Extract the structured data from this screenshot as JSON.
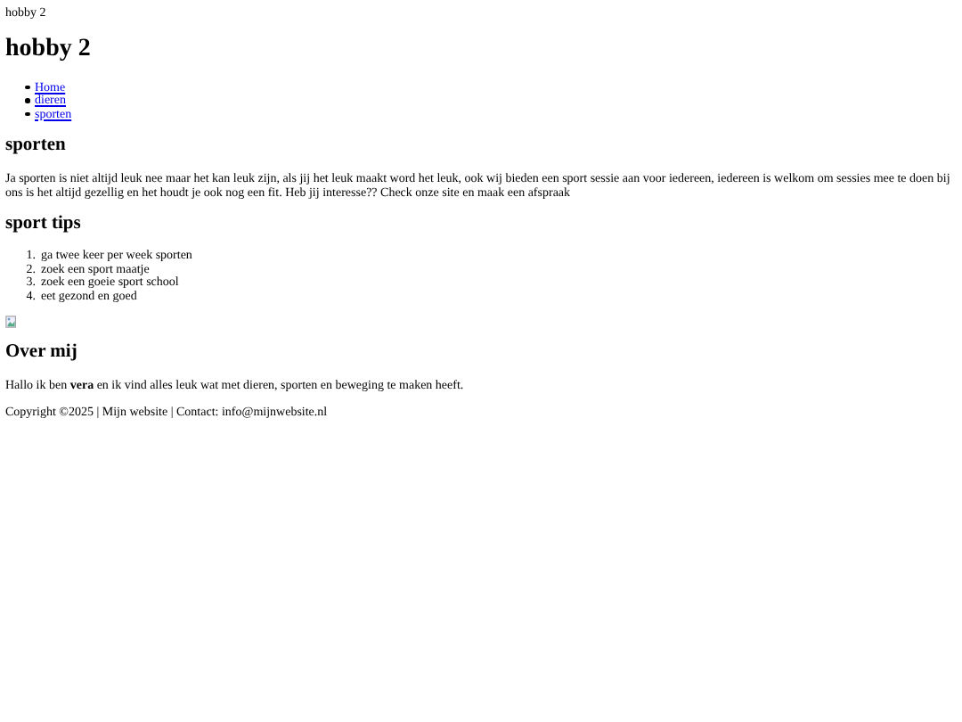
{
  "header": {
    "text": "hobby 2"
  },
  "title": "hobby 2",
  "nav": [
    {
      "label": "Home"
    },
    {
      "label": "dieren"
    },
    {
      "label": "sporten"
    }
  ],
  "section": {
    "heading": "sporten",
    "text": "Ja sporten is niet altijd leuk nee maar het kan leuk zijn, als jij het leuk maakt word het leuk, ook wij bieden een sport sessie aan voor iedereen, iedereen is welkom om sessies mee te doen bij ons is het altijd gezellig en het houdt je ook nog een fit. Heb jij interesse?? Check onze site en maak een afspraak"
  },
  "tips": {
    "heading": "sport tips",
    "markers": [
      "1.",
      "2.",
      "3.",
      "4."
    ],
    "items": [
      "ga twee keer per week sporten",
      "zoek een sport maatje",
      "zoek een goeie sport school",
      "eet gezond en goed"
    ]
  },
  "about": {
    "heading": "Over mij",
    "text": "Hallo ik ben **vera** en ik vind alles leuk wat met dieren, sporten en beweging te maken heeft."
  },
  "footer": "Copyright ©2025 | Mijn website | Contact: info@mijnwebsite.nl"
}
